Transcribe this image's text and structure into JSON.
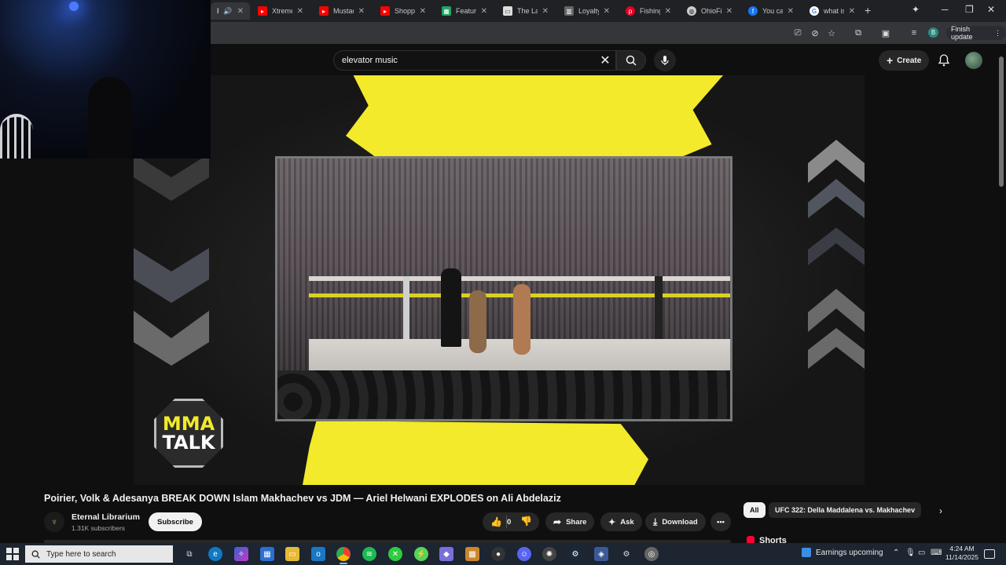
{
  "browser": {
    "tabs": [
      {
        "label": "Poirier",
        "favicon": "youtube-icon",
        "color": "#ff0000"
      },
      {
        "label": "Xtreme",
        "favicon": "youtube-icon",
        "color": "#ff0000"
      },
      {
        "label": "Mustad",
        "favicon": "youtube-icon",
        "color": "#ff0000"
      },
      {
        "label": "Shoppin",
        "favicon": "youtube-icon",
        "color": "#ff0000"
      },
      {
        "label": "Featured",
        "favicon": "sheets-icon",
        "color": "#1fa463"
      },
      {
        "label": "The Lan",
        "favicon": "page-icon",
        "color": "#dddddd"
      },
      {
        "label": "Loyalty",
        "favicon": "chart-icon",
        "color": "#888888"
      },
      {
        "label": "Fishing",
        "favicon": "pinterest-icon",
        "color": "#e60023"
      },
      {
        "label": "OhioFisl",
        "favicon": "globe-icon",
        "color": "#cccccc"
      },
      {
        "label": "You can",
        "favicon": "info-icon",
        "color": "#1877f2"
      },
      {
        "label": "what is",
        "favicon": "google-icon",
        "color": "#ffffff"
      }
    ],
    "finish_update": "Finish update",
    "profile_initial": "B"
  },
  "youtube": {
    "search_value": "elevator music",
    "create_label": "Create",
    "video": {
      "badge_line1": "MMA",
      "badge_line2": "TALK"
    },
    "title": "Poirier, Volk & Adesanya BREAK DOWN Islam Makhachev vs JDM — Ariel Helwani EXPLODES on Ali Abdelaziz",
    "channel": {
      "name": "Eternal Librarium",
      "subscribers": "1.31K subscribers",
      "subscribe_label": "Subscribe"
    },
    "actions": {
      "likes": "0",
      "share": "Share",
      "ask": "Ask",
      "download": "Download"
    },
    "chips": {
      "all": "All",
      "related": "UFC 322: Della Maddalena vs. Makhachev"
    },
    "shorts_label": "Shorts"
  },
  "taskbar": {
    "search_placeholder": "Type here to search",
    "earnings": "Earnings upcoming",
    "time": "4:24 AM",
    "date": "11/14/2025"
  }
}
